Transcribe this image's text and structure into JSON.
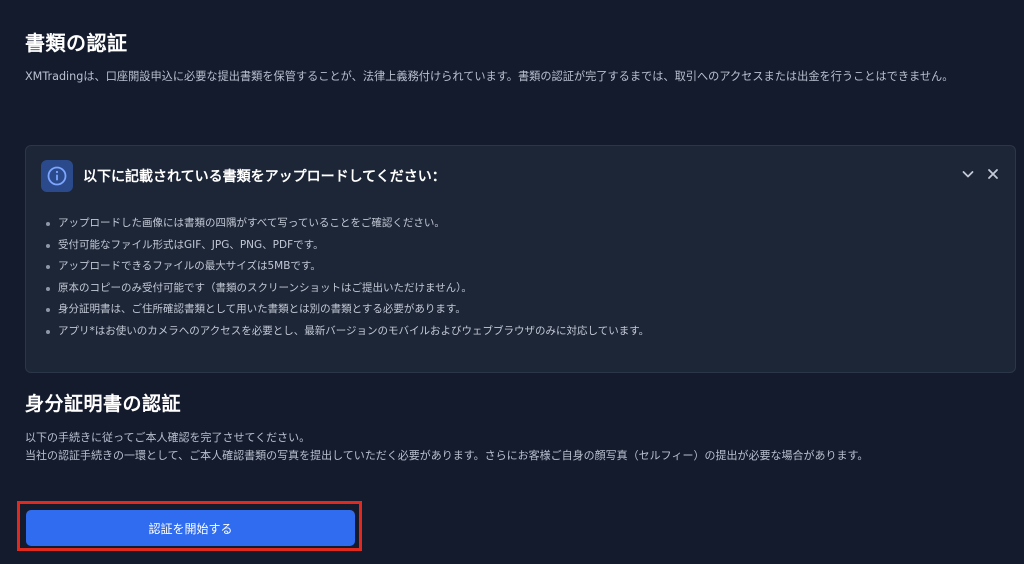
{
  "document_section": {
    "title": "書類の認証",
    "description": "XMTradingは、口座開設申込に必要な提出書類を保管することが、法律上義務付けられています。書類の認証が完了するまでは、取引へのアクセスまたは出金を行うことはできません。"
  },
  "notice": {
    "icon": "info-icon",
    "title": "以下に記載されている書類をアップロードしてください：",
    "items": [
      "アップロードした画像には書類の四隅がすべて写っていることをご確認ください。",
      "受付可能なファイル形式はGIF、JPG、PNG、PDFです。",
      "アップロードできるファイルの最大サイズは5MBです。",
      "原本のコピーのみ受付可能です（書類のスクリーンショットはご提出いただけません）。",
      "身分証明書は、ご住所確認書類として用いた書類とは別の書類とする必要があります。",
      "アプリ*はお使いのカメラへのアクセスを必要とし、最新バージョンのモバイルおよびウェブブラウザのみに対応しています。"
    ]
  },
  "identity_section": {
    "title": "身分証明書の認証",
    "line1": "以下の手続きに従ってご本人確認を完了させてください。",
    "line2": "当社の認証手続きの一環として、ご本人確認書類の写真を提出していただく必要があります。さらにお客様ご自身の顔写真（セルフィー）の提出が必要な場合があります。",
    "button_label": "認証を開始する"
  },
  "colors": {
    "background": "#141b2d",
    "panel": "#1d2637",
    "primary_button": "#2f6cf0",
    "highlight": "#e02a1f"
  }
}
